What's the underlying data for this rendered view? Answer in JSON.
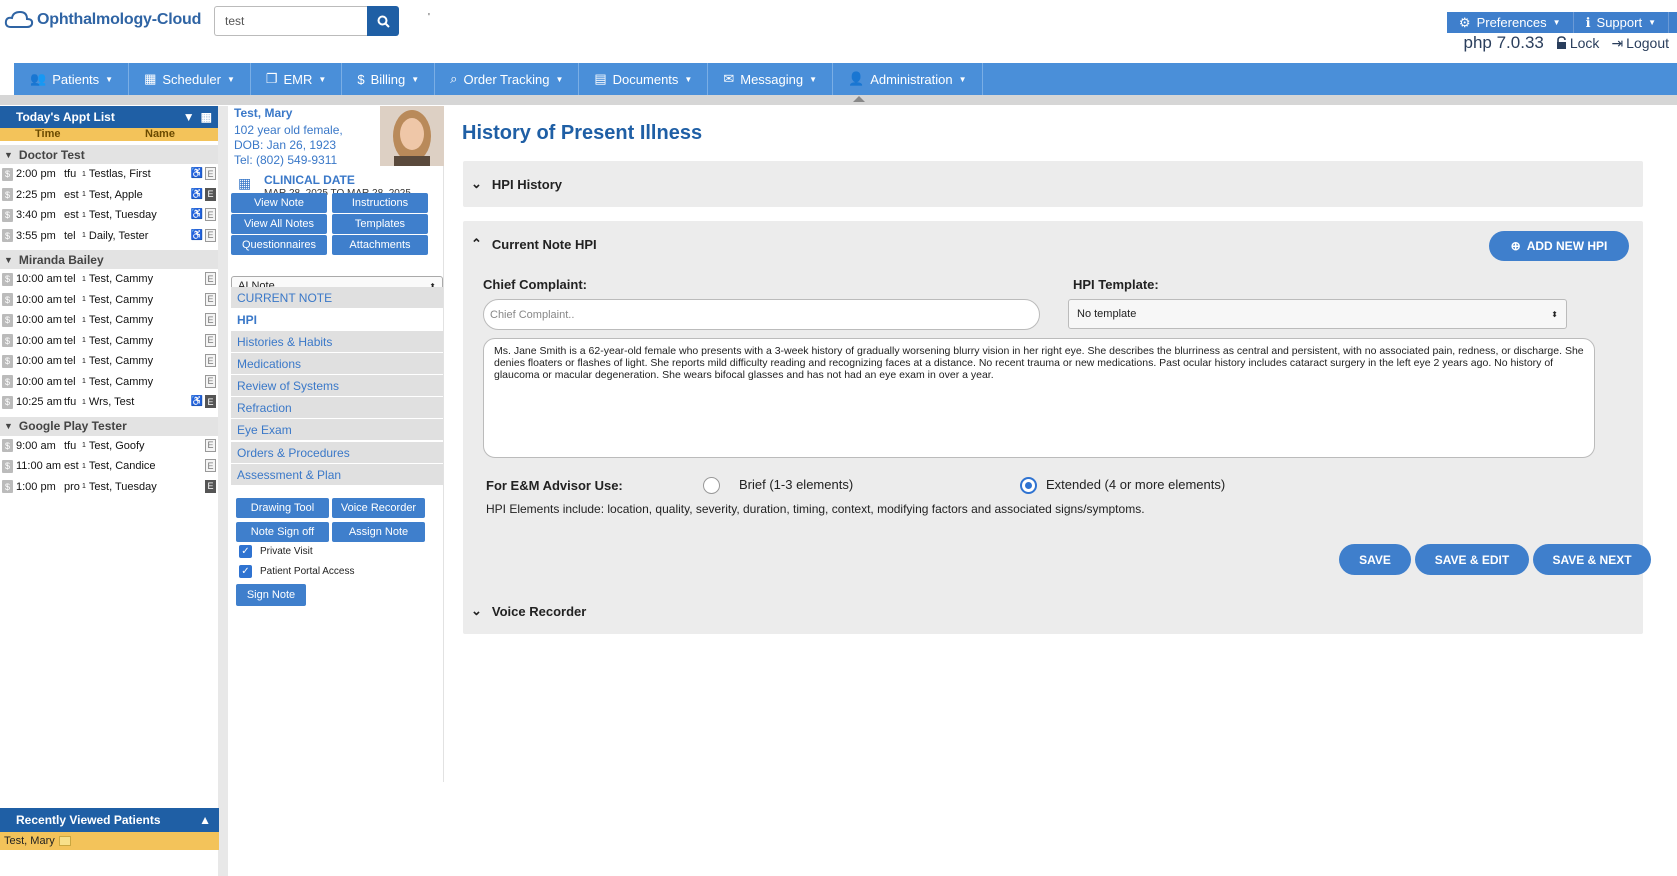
{
  "app": {
    "name": "Ophthalmology-Cloud"
  },
  "search": {
    "value": "test",
    "tick": "'"
  },
  "top_right": {
    "preferences_label": "Preferences",
    "support_label": "Support",
    "php_version": "php 7.0.33",
    "lock_label": "Lock",
    "logout_label": "Logout"
  },
  "nav": {
    "items": [
      {
        "label": "Patients",
        "icon": "users-icon"
      },
      {
        "label": "Scheduler",
        "icon": "calendar-icon"
      },
      {
        "label": "EMR",
        "icon": "copy-icon"
      },
      {
        "label": "Billing",
        "icon": "dollar-icon"
      },
      {
        "label": "Order Tracking",
        "icon": "search-icon"
      },
      {
        "label": "Documents",
        "icon": "document-icon"
      },
      {
        "label": "Messaging",
        "icon": "envelope-icon"
      },
      {
        "label": "Administration",
        "icon": "user-icon"
      }
    ]
  },
  "appt_list": {
    "title": "Today's Appt List",
    "col_time": "Time",
    "col_name": "Name",
    "groups": [
      {
        "doctor": "Doctor Test",
        "rows": [
          {
            "time": "2:00 pm",
            "type": "tfu",
            "name": "Testlas, First",
            "sup": "1",
            "access": true,
            "e_dark": false
          },
          {
            "time": "2:25 pm",
            "type": "est",
            "name": "Test, Apple",
            "sup": "1",
            "access": true,
            "e_dark": true
          },
          {
            "time": "3:40 pm",
            "type": "est",
            "name": "Test, Tuesday",
            "sup": "1",
            "access": true,
            "e_dark": false
          },
          {
            "time": "3:55 pm",
            "type": "tel",
            "name": "Daily, Tester",
            "sup": "1",
            "access": true,
            "e_dark": false
          }
        ]
      },
      {
        "doctor": "Miranda Bailey",
        "rows": [
          {
            "time": "10:00 am",
            "type": "tel",
            "name": "Test, Cammy",
            "sup": "1",
            "access": false,
            "e_dark": false
          },
          {
            "time": "10:00 am",
            "type": "tel",
            "name": "Test, Cammy",
            "sup": "1",
            "access": false,
            "e_dark": false
          },
          {
            "time": "10:00 am",
            "type": "tel",
            "name": "Test, Cammy",
            "sup": "1",
            "access": false,
            "e_dark": false
          },
          {
            "time": "10:00 am",
            "type": "tel",
            "name": "Test, Cammy",
            "sup": "1",
            "access": false,
            "e_dark": false
          },
          {
            "time": "10:00 am",
            "type": "tel",
            "name": "Test, Cammy",
            "sup": "1",
            "access": false,
            "e_dark": false
          },
          {
            "time": "10:00 am",
            "type": "tel",
            "name": "Test, Cammy",
            "sup": "1",
            "access": false,
            "e_dark": false
          },
          {
            "time": "10:25 am",
            "type": "tfu",
            "name": "Wrs, Test",
            "sup": "1",
            "access": true,
            "e_dark": true
          }
        ]
      },
      {
        "doctor": "Google Play Tester",
        "rows": [
          {
            "time": "9:00 am",
            "type": "tfu",
            "name": "Test, Goofy",
            "sup": "1",
            "access": false,
            "e_dark": false
          },
          {
            "time": "11:00 am",
            "type": "est",
            "name": "Test, Candice",
            "sup": "1",
            "access": false,
            "e_dark": false
          },
          {
            "time": "1:00 pm",
            "type": "pro",
            "name": "Test, Tuesday",
            "sup": "1",
            "access": false,
            "e_dark": true
          }
        ]
      }
    ],
    "recent_title": "Recently Viewed Patients",
    "recent_patient": "Test, Mary"
  },
  "patient": {
    "name": "Test, Mary",
    "age_sex": "102 year old female,",
    "dob": "DOB: Jan 26, 1923",
    "tel": "Tel: (802) 549-9311",
    "clinical_date_label": "CLINICAL DATE",
    "clinical_date_range": "MAR 28, 2025 TO MAR 28, 2025"
  },
  "patient_buttons": {
    "view_note": "View Note",
    "instructions": "Instructions",
    "view_all_notes": "View All Notes",
    "templates": "Templates",
    "questionnaires": "Questionnaires",
    "attachments": "Attachments"
  },
  "note_select": {
    "value": "AI Note"
  },
  "side_menu": [
    "CURRENT NOTE",
    "HPI",
    "Histories & Habits",
    "Medications",
    "Review of Systems",
    "Refraction",
    "Eye Exam",
    "Orders & Procedures",
    "Assessment & Plan"
  ],
  "tools": {
    "drawing_tool": "Drawing Tool",
    "voice_recorder": "Voice Recorder",
    "note_sign_off": "Note Sign off",
    "assign_note": "Assign Note",
    "private_visit": "Private Visit",
    "patient_portal": "Patient Portal Access",
    "sign_note": "Sign Note"
  },
  "main": {
    "title": "History of Present Illness",
    "hpi_history": "HPI History",
    "current_note_hpi": "Current Note HPI",
    "add_new_hpi": "ADD NEW HPI",
    "chief_complaint_label": "Chief Complaint:",
    "chief_complaint_placeholder": "Chief Complaint..",
    "hpi_template_label": "HPI Template:",
    "hpi_template_value": "No template",
    "hpi_text": "Ms. Jane Smith is a 62-year-old female who presents with a 3-week history of gradually worsening blurry vision in her right eye. She describes the blurriness as central and persistent, with no associated pain, redness, or discharge. She denies floaters or flashes of light. She reports mild difficulty reading and recognizing faces at a distance. No recent trauma or new medications. Past ocular history includes cataract surgery in the left eye 2 years ago. No history of glaucoma or macular degeneration. She wears bifocal glasses and has not had an eye exam in over a year.",
    "advisor_label": "For E&M Advisor Use:",
    "brief_label": "Brief (1-3 elements)",
    "extended_label": "Extended (4 or more elements)",
    "selected_option": "Extended (4 or more elements)",
    "elements_note": "HPI Elements include: location, quality, severity, duration, timing, context, modifying factors and associated signs/symptoms.",
    "save": "SAVE",
    "save_edit": "SAVE & EDIT",
    "save_next": "SAVE & NEXT",
    "voice_recorder": "Voice Recorder"
  },
  "colors": {
    "brand": "#1f5fa5",
    "nav": "#4a8fd9",
    "button": "#3f7fcc",
    "highlight": "#f3c35a"
  }
}
